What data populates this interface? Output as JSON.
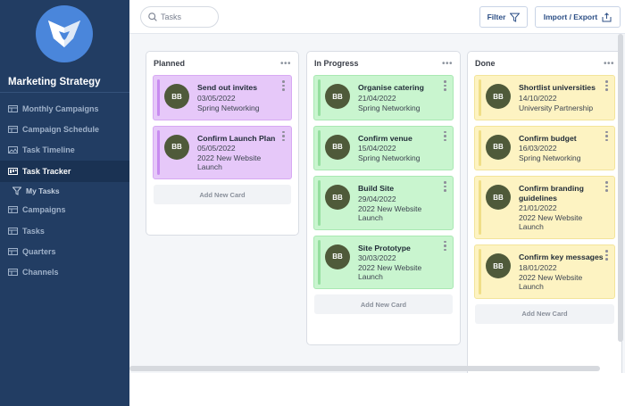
{
  "app": {
    "title": "Marketing Strategy"
  },
  "colors": {
    "sidebar": "#223d63",
    "accent": "#2c4f86",
    "planned_card": "#e6c8f9",
    "progress_card": "#c9f5cf",
    "done_card": "#fdf3c2"
  },
  "sidebar": {
    "items": [
      {
        "label": "Monthly Campaigns",
        "icon": "table-icon"
      },
      {
        "label": "Campaign Schedule",
        "icon": "table-icon"
      },
      {
        "label": "Task Timeline",
        "icon": "image-icon"
      },
      {
        "label": "Task Tracker",
        "icon": "kanban-icon"
      },
      {
        "label": "My Tasks",
        "icon": "filter-icon"
      },
      {
        "label": "Campaigns",
        "icon": "table-icon"
      },
      {
        "label": "Tasks",
        "icon": "table-icon"
      },
      {
        "label": "Quarters",
        "icon": "table-icon"
      },
      {
        "label": "Channels",
        "icon": "table-icon"
      }
    ]
  },
  "toolbar": {
    "search_placeholder": "Tasks",
    "filter_label": "Filter",
    "import_export_label": "Import / Export"
  },
  "board": {
    "add_card_label": "Add New Card",
    "columns": [
      {
        "title": "Planned",
        "cards": [
          {
            "initials": "BB",
            "title": "Send out invites",
            "date": "03/05/2022",
            "project": "Spring Networking"
          },
          {
            "initials": "BB",
            "title": "Confirm Launch Plan",
            "date": "05/05/2022",
            "project": "2022 New Website Launch"
          }
        ]
      },
      {
        "title": "In Progress",
        "cards": [
          {
            "initials": "BB",
            "title": "Organise catering",
            "date": "21/04/2022",
            "project": "Spring Networking"
          },
          {
            "initials": "BB",
            "title": "Confirm venue",
            "date": "15/04/2022",
            "project": "Spring Networking"
          },
          {
            "initials": "BB",
            "title": "Build Site",
            "date": "29/04/2022",
            "project": "2022 New Website Launch"
          },
          {
            "initials": "BB",
            "title": "Site Prototype",
            "date": "30/03/2022",
            "project": "2022 New Website Launch"
          }
        ]
      },
      {
        "title": "Done",
        "cards": [
          {
            "initials": "BB",
            "title": "Shortlist universities",
            "date": "14/10/2022",
            "project": "University Partnership"
          },
          {
            "initials": "BB",
            "title": "Confirm budget",
            "date": "16/03/2022",
            "project": "Spring Networking"
          },
          {
            "initials": "BB",
            "title": "Confirm branding guidelines",
            "date": "21/01/2022",
            "project": "2022 New Website Launch"
          },
          {
            "initials": "BB",
            "title": "Confirm key messages",
            "date": "18/01/2022",
            "project": "2022 New Website Launch"
          }
        ]
      }
    ]
  }
}
